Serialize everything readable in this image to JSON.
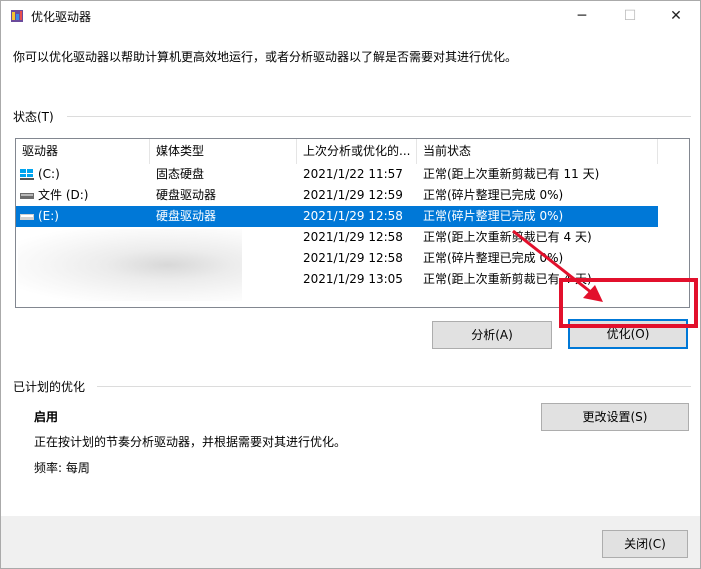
{
  "window": {
    "title": "优化驱动器",
    "minimize_glyph": "─",
    "maximize_glyph": "☐",
    "close_glyph": "✕"
  },
  "intro_text": "你可以优化驱动器以帮助计算机更高效地运行，或者分析驱动器以了解是否需要对其进行优化。",
  "status_group": {
    "label": "状态(T)"
  },
  "table": {
    "columns": [
      "驱动器",
      "媒体类型",
      "上次分析或优化的...",
      "当前状态"
    ],
    "rows": [
      {
        "drive": "(C:)",
        "media": "固态硬盘",
        "last": "2021/1/22 11:57",
        "status": "正常(距上次重新剪裁已有 11 天)",
        "icon": "ssd-drive-icon"
      },
      {
        "drive": "文件 (D:)",
        "media": "硬盘驱动器",
        "last": "2021/1/29 12:59",
        "status": "正常(碎片整理已完成 0%)",
        "icon": "hdd-drive-icon"
      },
      {
        "drive": "(E:)",
        "media": "硬盘驱动器",
        "last": "2021/1/29 12:58",
        "status": "正常(碎片整理已完成 0%)",
        "icon": "hdd-drive-icon",
        "selected": true
      },
      {
        "drive": "",
        "media": "",
        "last": "2021/1/29 12:58",
        "status": "正常(距上次重新剪裁已有 4 天)"
      },
      {
        "drive": "",
        "media": "",
        "last": "2021/1/29 12:58",
        "status": "正常(碎片整理已完成 0%)"
      },
      {
        "drive": "",
        "media": "",
        "last": "2021/1/29 13:05",
        "status": "正常(距上次重新剪裁已有 4 天)"
      }
    ]
  },
  "buttons": {
    "analyze": "分析(A)",
    "optimize": "优化(O)",
    "change_settings": "更改设置(S)",
    "close": "关闭(C)"
  },
  "schedule": {
    "label": "已计划的优化",
    "state": "启用",
    "description": "正在按计划的节奏分析驱动器，并根据需要对其进行优化。",
    "frequency": "频率: 每周"
  },
  "colors": {
    "selection": "#0078d7",
    "annotation": "#e2102c"
  }
}
